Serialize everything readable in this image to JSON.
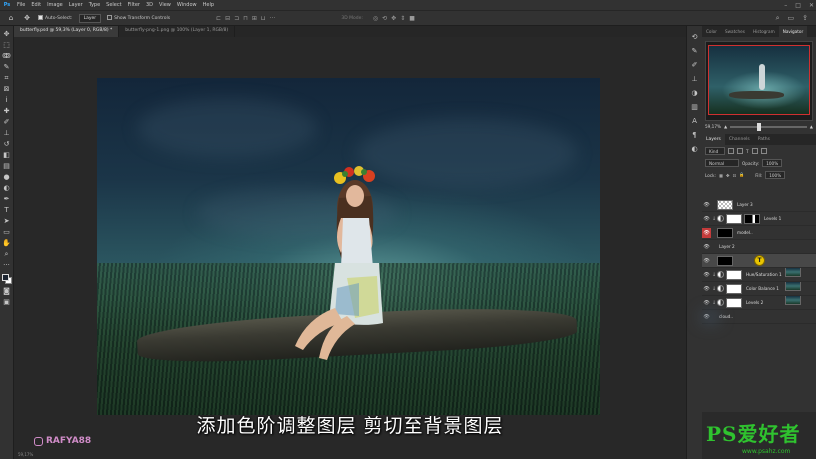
{
  "menubar": {
    "logo": "Ps",
    "items": [
      "File",
      "Edit",
      "Image",
      "Layer",
      "Type",
      "Select",
      "Filter",
      "3D",
      "View",
      "Window",
      "Help"
    ]
  },
  "options": {
    "auto_select_label": "Auto-Select:",
    "auto_select_value": "Layer",
    "show_transform_label": "Show Transform Controls",
    "mode_3d": "3D Mode:"
  },
  "tabs": [
    {
      "label": "butterfly.psd @ 59,3% (Layer 0, RGB/8) *",
      "active": true
    },
    {
      "label": "butterfly-png-1.png @ 100% (Layer 1, RGB/8)",
      "active": false
    }
  ],
  "panels": {
    "top_tabs": [
      "Color",
      "Swatches",
      "Histogram",
      "Navigator"
    ],
    "zoom": "59,17%",
    "layer_tabs": [
      "Layers",
      "Channels",
      "Paths"
    ],
    "kind_label": "Kind",
    "blend_mode": "Normal",
    "opacity_label": "Opacity:",
    "opacity_value": "100%",
    "lock_label": "Lock:",
    "fill_label": "Fill:",
    "fill_value": "100%"
  },
  "layers": [
    {
      "name": "Layer 3",
      "thumb": "ck",
      "mask": "",
      "adj": false,
      "clip": false,
      "eye": "normal",
      "selected": false
    },
    {
      "name": "Levels 1",
      "thumb": "white",
      "mask": "mask-sil",
      "adj": true,
      "clip": true,
      "eye": "normal",
      "selected": false
    },
    {
      "name": "model..",
      "thumb": "photo",
      "mask": "black",
      "adj": false,
      "clip": false,
      "eye": "red",
      "selected": false
    },
    {
      "name": "Layer 2",
      "thumb": "photo",
      "mask": "",
      "adj": false,
      "clip": false,
      "eye": "normal",
      "selected": false
    },
    {
      "name": "",
      "thumb": "photo",
      "mask": "black",
      "adj": false,
      "clip": false,
      "eye": "normal",
      "selected": true
    },
    {
      "name": "Hue/Saturation 1",
      "thumb": "white",
      "mask": "",
      "adj": true,
      "clip": true,
      "eye": "normal",
      "selected": false
    },
    {
      "name": "Color Balance 1",
      "thumb": "white",
      "mask": "",
      "adj": true,
      "clip": true,
      "eye": "normal",
      "selected": false
    },
    {
      "name": "Levels 2",
      "thumb": "white",
      "mask": "",
      "adj": true,
      "clip": true,
      "eye": "normal",
      "selected": false
    },
    {
      "name": "cloud..",
      "thumb": "cloud",
      "mask": "",
      "adj": false,
      "clip": false,
      "eye": "normal",
      "selected": false
    }
  ],
  "cursor_label": "T",
  "subtitle": "添加色阶调整图层 剪切至背景图层",
  "watermark": "RAFYA88",
  "logo": {
    "main": "PS爱好者",
    "sub": "www.psahz.com"
  },
  "status": "59,17%"
}
